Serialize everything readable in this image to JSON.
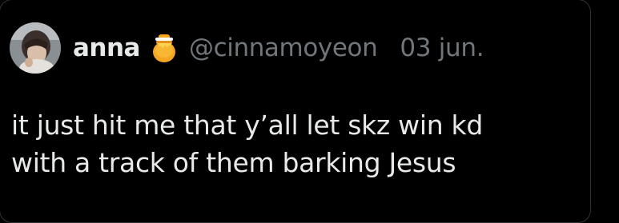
{
  "tweet": {
    "author": {
      "display_name": "anna",
      "badge_icon": "honey-pot-icon",
      "handle": "@cinnamoyeon",
      "avatar_icon": "avatar-icon"
    },
    "date": "03 jun.",
    "text_lines": [
      "it just hit me that y’all let skz win kd",
      "with a track of them barking Jesus"
    ]
  },
  "colors": {
    "background": "#000000",
    "primary_text": "#e7e9ea",
    "secondary_text": "#71767b",
    "border": "#2f3336"
  }
}
